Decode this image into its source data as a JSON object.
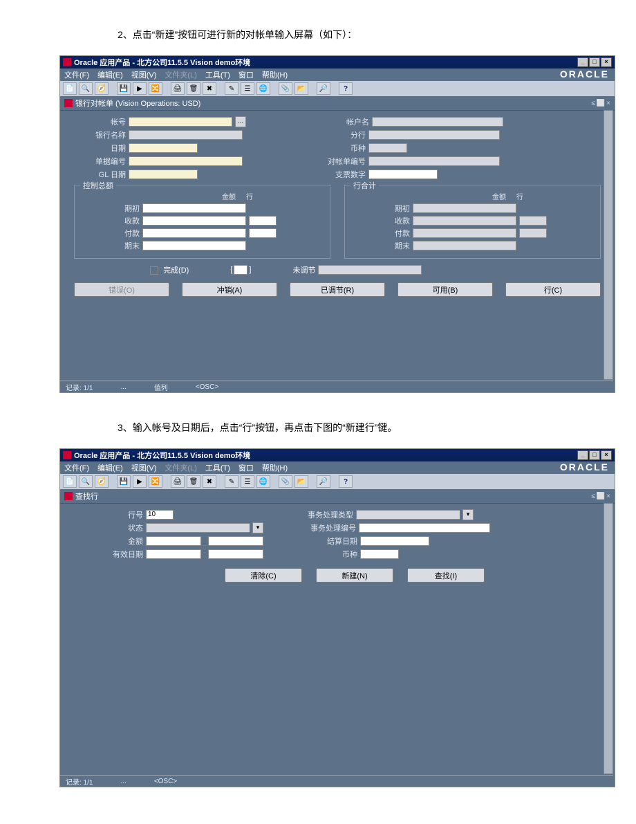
{
  "doc": {
    "step2": "2、点击“新建”按钮可进行新的对帐单输入屏幕（如下）：",
    "step3": "3、输入帐号及日期后，点击“行”按钮，再点击下图的“新建行”键。"
  },
  "common": {
    "app_title": "Oracle 应用产品 - 北方公司11.5.5 Vision demo环境",
    "menus": {
      "file": "文件(F)",
      "edit": "编辑(E)",
      "view": "视图(V)",
      "folder": "文件夹(L)",
      "tools": "工具(T)",
      "window": "窗口",
      "help": "帮助(H)"
    },
    "oracle": "ORACLE",
    "status": {
      "record": "记录: 1/1",
      "list": "...",
      "value_lbl": "值列",
      "osc": "<OSC>"
    }
  },
  "scr1": {
    "window_title": "银行对帐单 (Vision Operations: USD)",
    "left": {
      "account_no": "帐号",
      "bank_name": "银行名称",
      "date": "日期",
      "doc_no": "单据编号",
      "gl_date": "GL 日期"
    },
    "right": {
      "account_name": "帐户名",
      "branch": "分行",
      "currency": "币种",
      "stmt_no": "对帐单编号",
      "check_digits": "支票数字"
    },
    "group_left": "控制总额",
    "group_right": "行合计",
    "col_amount": "金额",
    "col_line": "行",
    "rows": {
      "opening": "期初",
      "receipts": "收款",
      "payments": "付款",
      "closing": "期末"
    },
    "complete": "完成(D)",
    "unreconciled": "未调节",
    "buttons": {
      "errors": "错误(O)",
      "reversal": "冲销(A)",
      "reconciled": "已调节(R)",
      "available": "可用(B)",
      "lines": "行(C)"
    }
  },
  "scr2": {
    "window_title": "查找行",
    "left": {
      "line_no": "行号",
      "status": "状态",
      "amount": "金额",
      "eff_date": "有效日期"
    },
    "line_value": "10",
    "right": {
      "trx_type": "事务处理类型",
      "trx_no": "事务处理编号",
      "settle_date": "结算日期",
      "currency": "币种"
    },
    "buttons": {
      "clear": "清除(C)",
      "new": "新建(N)",
      "find": "查找(I)"
    }
  }
}
